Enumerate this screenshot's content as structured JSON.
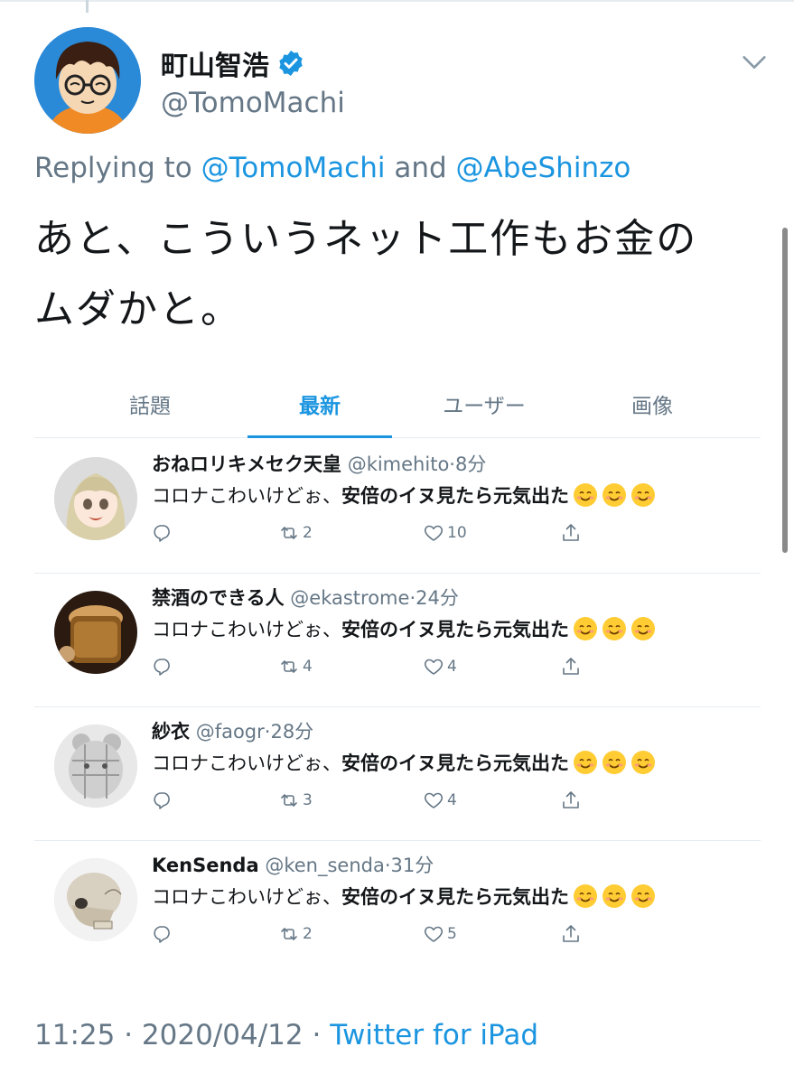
{
  "tweet": {
    "display_name": "町山智浩",
    "handle": "@TomoMachi",
    "replying_prefix": "Replying to",
    "replying_to_1": "@TomoMachi",
    "replying_and": "and",
    "replying_to_2": "@AbeShinzo",
    "text_line1": "あと、こういうネット工作もお金の",
    "text_line2": "ムダかと。",
    "time": "11:25",
    "separator": "·",
    "date": "2020/04/12",
    "source": "Twitter for iPad"
  },
  "tabs": [
    {
      "label": "話題"
    },
    {
      "label": "最新"
    },
    {
      "label": "ユーザー"
    },
    {
      "label": "画像"
    }
  ],
  "replies": [
    {
      "name": "おねロリキメセク天皇",
      "handle": "@kimehito",
      "time": "8分",
      "text_plain": "コロナこわいけどぉ、",
      "text_bold": "安倍のイヌ見たら元気出た",
      "retweets": "2",
      "likes": "10"
    },
    {
      "name": "禁酒のできる人",
      "handle": "@ekastrome",
      "time": "24分",
      "text_plain": "コロナこわいけどぉ、",
      "text_bold": "安倍のイヌ見たら元気出た",
      "retweets": "4",
      "likes": "4"
    },
    {
      "name": "紗衣",
      "handle": "@faogr",
      "time": "28分",
      "text_plain": "コロナこわいけどぉ、",
      "text_bold": "安倍のイヌ見たら元気出た",
      "retweets": "3",
      "likes": "4"
    },
    {
      "name": "KenSenda",
      "handle": "@ken_senda",
      "time": "31分",
      "text_plain": "コロナこわいけどぉ、",
      "text_bold": "安倍のイヌ見たら元気出た",
      "retweets": "2",
      "likes": "5"
    }
  ],
  "icons": {
    "verified": "verified-badge-icon",
    "chevron": "chevron-down-icon",
    "reply": "reply-icon",
    "retweet": "retweet-icon",
    "like": "heart-icon",
    "share": "share-icon",
    "emoji": "smiling-face-emoji"
  },
  "colors": {
    "accent": "#1b95e0",
    "secondary_text": "#657786",
    "primary_text": "#14171a",
    "divider": "#e6ecf0"
  }
}
